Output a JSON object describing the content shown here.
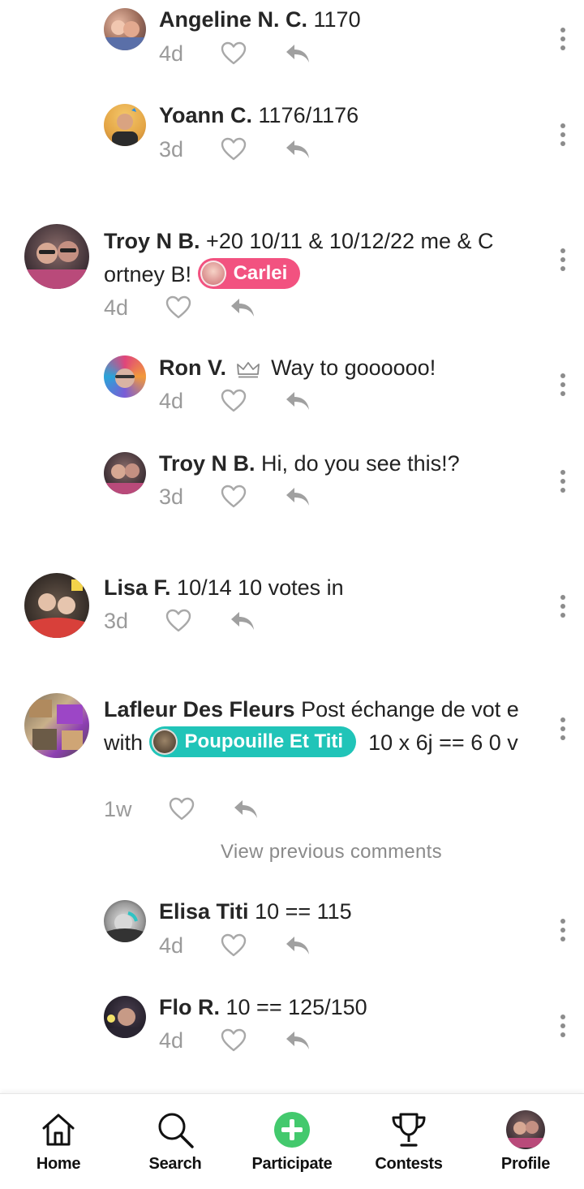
{
  "comments": [
    {
      "author": "Angeline N. C.",
      "text": "1170",
      "time": "4d",
      "avatar": "avatar-angeline"
    },
    {
      "author": "Yoann C.",
      "text": "1176/1176",
      "time": "3d",
      "avatar": "avatar-yoann"
    },
    {
      "author": "Troy N B.",
      "text": "+20 10/11 & 10/12/22 me & C ortney B!",
      "mention": "Carlei",
      "time": "4d",
      "avatar": "avatar-troy"
    },
    {
      "author": "Ron V.",
      "text": "Way to goooooo!",
      "time": "4d",
      "avatar": "avatar-ron",
      "badge": "crown-icon"
    },
    {
      "author": "Troy N B.",
      "text": "Hi, do you see this!?",
      "time": "3d",
      "avatar": "avatar-troy"
    },
    {
      "author": "Lisa F.",
      "text": "10/14 10 votes in",
      "time": "3d",
      "avatar": "avatar-lisa"
    },
    {
      "author": "Lafleur Des Fleurs",
      "text_before": "Post échange de vot e with",
      "mention": "Poupouille Et Titi",
      "text_after": "10 x 6j == 6 0 v",
      "time": "1w",
      "avatar": "avatar-lafleur"
    },
    {
      "author": "Elisa Titi",
      "text": "10 == 115",
      "time": "4d",
      "avatar": "avatar-elisa"
    },
    {
      "author": "Flo R.",
      "text": "10 == 125/150",
      "time": "4d",
      "avatar": "avatar-flo"
    }
  ],
  "view_previous": "View previous comments",
  "nav": {
    "home": "Home",
    "search": "Search",
    "participate": "Participate",
    "contests": "Contests",
    "profile": "Profile"
  },
  "colors": {
    "accent_green": "#43c96d",
    "chip_pink": "#f25280",
    "chip_teal": "#20c4b8",
    "muted": "#9a9a9a"
  }
}
